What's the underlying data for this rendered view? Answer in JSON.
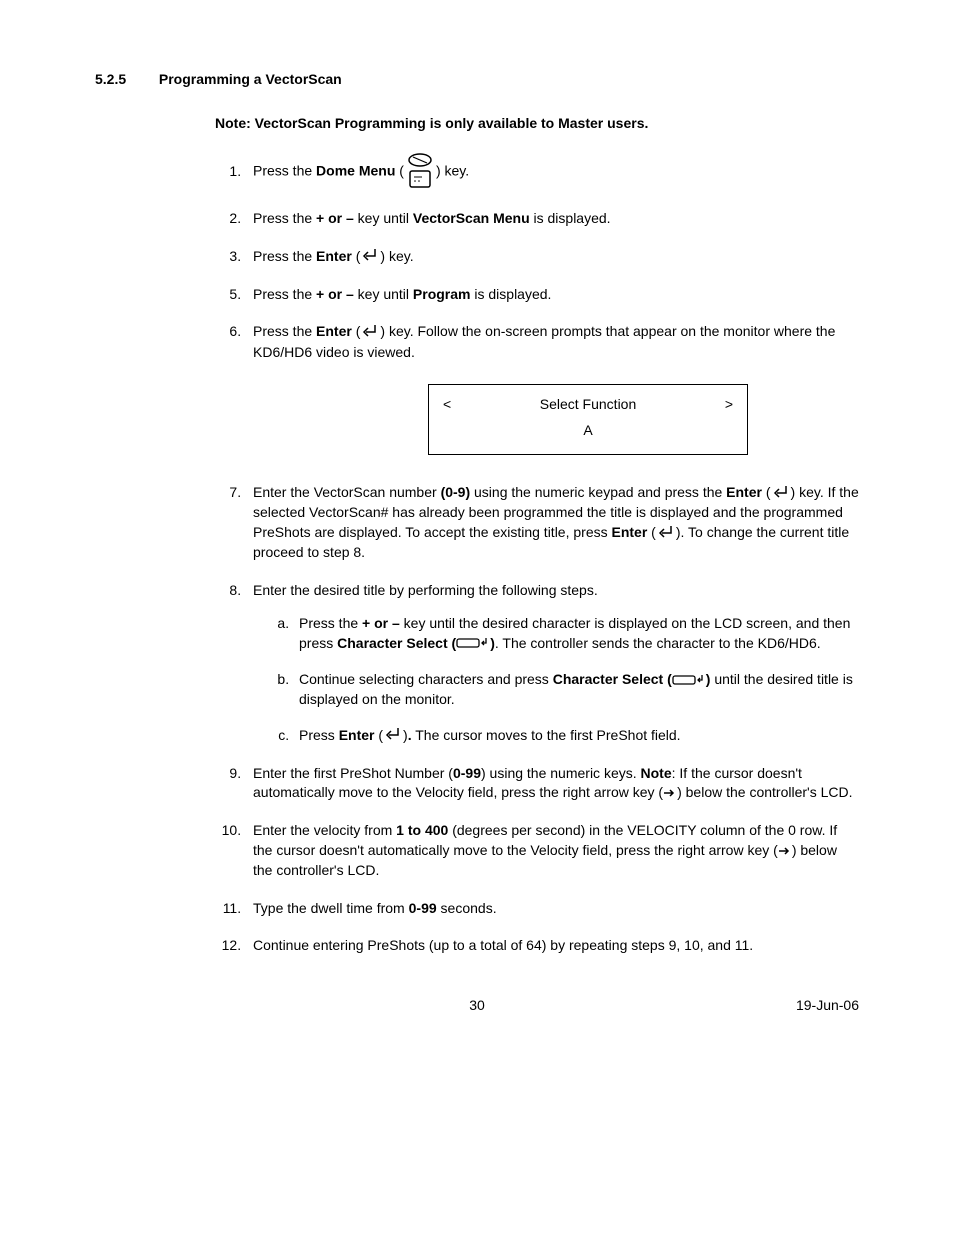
{
  "section": {
    "number": "5.2.5",
    "title": "Programming a VectorScan"
  },
  "note": {
    "prefix": "N",
    "text": "ote:  VectorScan Programming is only available to Master users."
  },
  "steps": {
    "s1_a": "Press the ",
    "s1_b": "Dome Menu",
    "s1_c": " (",
    "s1_d": ") key.",
    "s2_a": "Press the ",
    "s2_b": "+ or –",
    "s2_c": " key until ",
    "s2_d": "VectorScan Menu",
    "s2_e": " is displayed.",
    "s3_a": "Press the ",
    "s3_b": "Enter",
    "s3_c": " (",
    "s3_d": ") key.",
    "s5_a": "Press the ",
    "s5_b": "+ or –",
    "s5_c": " key until ",
    "s5_d": "Program",
    "s5_e": " is displayed.",
    "s6_a": "Press the ",
    "s6_b": "Enter",
    "s6_c": " (",
    "s6_d": ") key.  Follow the on-screen prompts that appear on the monitor where the KD6/HD6 video is viewed.",
    "s7_a": "Enter the VectorScan number ",
    "s7_b": "(0-9)",
    "s7_c": " using the numeric keypad and press the ",
    "s7_d": "Enter",
    "s7_e": " (",
    "s7_f": ") key.  If the selected VectorScan# has already been programmed the title is displayed and the programmed PreShots are displayed.  To accept the existing title, press ",
    "s7_g": "Enter",
    "s7_h": " (",
    "s7_i": ").  To change the current title proceed to step 8.",
    "s8_a": "Enter the desired title by performing the following steps.",
    "s8a_a": "Press the ",
    "s8a_b": "+ or –",
    "s8a_c": " key until the desired character is displayed on the LCD screen, and then press ",
    "s8a_d": "Character Select (",
    "s8a_e": ")",
    "s8a_f": ".  The controller sends the character to the KD6/HD6.",
    "s8b_a": "Continue selecting characters and press ",
    "s8b_b": "Character Select (",
    "s8b_c": ")",
    "s8b_d": " until the desired title is displayed on the monitor.",
    "s8c_a": "Press ",
    "s8c_b": "Enter",
    "s8c_c": " (",
    "s8c_d": ")",
    "s8c_e": ".",
    "s8c_f": "   The cursor moves to the first PreShot field.",
    "s9_a": "Enter the first PreShot Number (",
    "s9_b": "0-99",
    "s9_c": ") using the numeric keys.  ",
    "s9_d": "Note",
    "s9_e": ":  If the cursor doesn't automatically move to the Velocity field, press the right arrow key (",
    "s9_f": ") below the controller's LCD.",
    "s10_a": "Enter the velocity from ",
    "s10_b": "1 to 400",
    "s10_c": " (degrees per second) in the VELOCITY column of the 0 row.  If the cursor doesn't automatically move to the Velocity field, press the right arrow key (",
    "s10_d": ") below the controller's LCD.",
    "s11_a": "Type the dwell time from ",
    "s11_b": "0-99",
    "s11_c": " seconds.",
    "s12_a": "Continue entering PreShots (up to a total of 64) by repeating steps 9, 10, and 11."
  },
  "display": {
    "left": "<",
    "center": "Select Function",
    "right": ">",
    "line2": "A"
  },
  "footer": {
    "page": "30",
    "date": "19-Jun-06"
  }
}
